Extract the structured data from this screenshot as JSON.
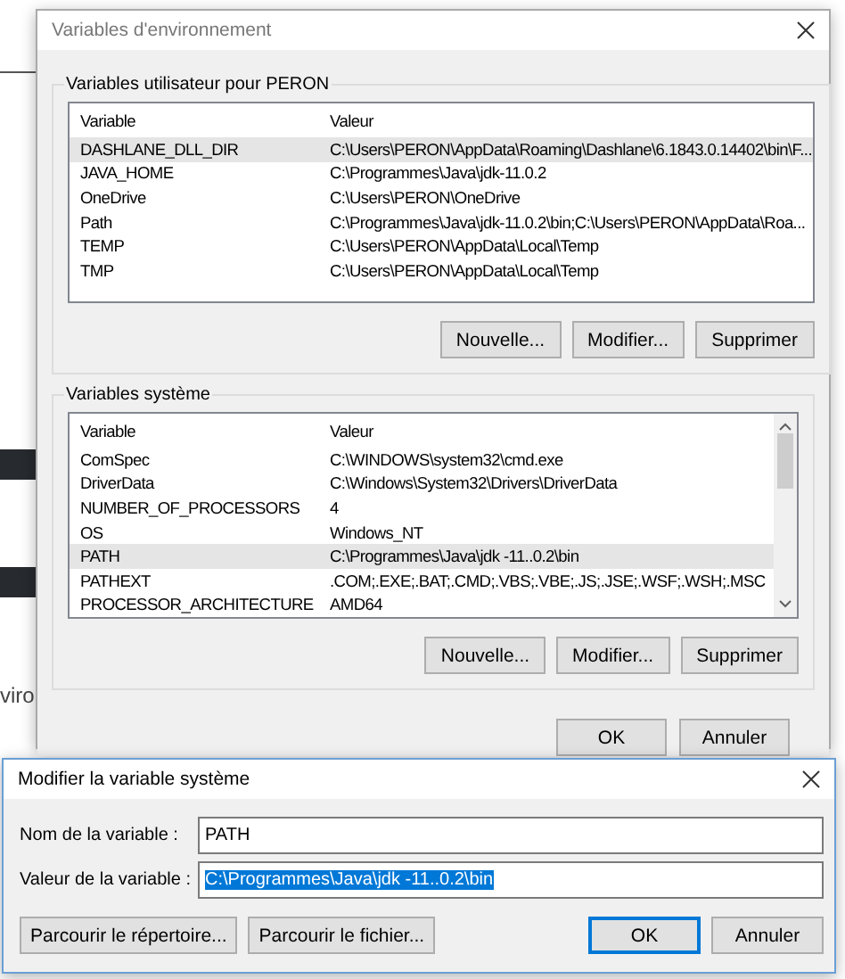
{
  "background_page": {
    "text": "viro"
  },
  "env_dialog": {
    "title": "Variables d'environnement",
    "user_group": {
      "label": "Variables utilisateur pour PERON",
      "columns": [
        "Variable",
        "Valeur"
      ],
      "rows": [
        {
          "variable": "DASHLANE_DLL_DIR",
          "value": "C:\\Users\\PERON\\AppData\\Roaming\\Dashlane\\6.1843.0.14402\\bin\\F...",
          "selected": true
        },
        {
          "variable": "JAVA_HOME",
          "value": "C:\\Programmes\\Java\\jdk-11.0.2",
          "selected": false
        },
        {
          "variable": "OneDrive",
          "value": "C:\\Users\\PERON\\OneDrive",
          "selected": false
        },
        {
          "variable": "Path",
          "value": "C:\\Programmes\\Java\\jdk-11.0.2\\bin;C:\\Users\\PERON\\AppData\\Roa...",
          "selected": false
        },
        {
          "variable": "TEMP",
          "value": "C:\\Users\\PERON\\AppData\\Local\\Temp",
          "selected": false
        },
        {
          "variable": "TMP",
          "value": "C:\\Users\\PERON\\AppData\\Local\\Temp",
          "selected": false
        }
      ],
      "buttons": [
        "Nouvelle...",
        "Modifier...",
        "Supprimer"
      ]
    },
    "system_group": {
      "label": "Variables système",
      "columns": [
        "Variable",
        "Valeur"
      ],
      "rows": [
        {
          "variable": "ComSpec",
          "value": "C:\\WINDOWS\\system32\\cmd.exe",
          "selected": false
        },
        {
          "variable": "DriverData",
          "value": "C:\\Windows\\System32\\Drivers\\DriverData",
          "selected": false
        },
        {
          "variable": "NUMBER_OF_PROCESSORS",
          "value": "4",
          "selected": false
        },
        {
          "variable": "OS",
          "value": "Windows_NT",
          "selected": false
        },
        {
          "variable": "PATH",
          "value": "C:\\Programmes\\Java\\jdk -11..0.2\\bin",
          "selected": true
        },
        {
          "variable": "PATHEXT",
          "value": ".COM;.EXE;.BAT;.CMD;.VBS;.VBE;.JS;.JSE;.WSF;.WSH;.MSC",
          "selected": false
        },
        {
          "variable": "PROCESSOR_ARCHITECTURE",
          "value": "AMD64",
          "selected": false
        }
      ],
      "buttons": [
        "Nouvelle...",
        "Modifier...",
        "Supprimer"
      ]
    },
    "buttons": [
      "OK",
      "Annuler"
    ]
  },
  "edit_dialog": {
    "title": "Modifier la variable système",
    "fields": [
      {
        "label": "Nom de la variable :",
        "value": "PATH",
        "selected": false
      },
      {
        "label": "Valeur de la variable :",
        "value": "C:\\Programmes\\Java\\jdk -11..0.2\\bin",
        "selected": true
      }
    ],
    "left_buttons": [
      "Parcourir le répertoire...",
      "Parcourir le fichier..."
    ],
    "buttons": [
      {
        "label": "OK",
        "default": true
      },
      {
        "label": "Annuler",
        "default": false
      }
    ]
  }
}
